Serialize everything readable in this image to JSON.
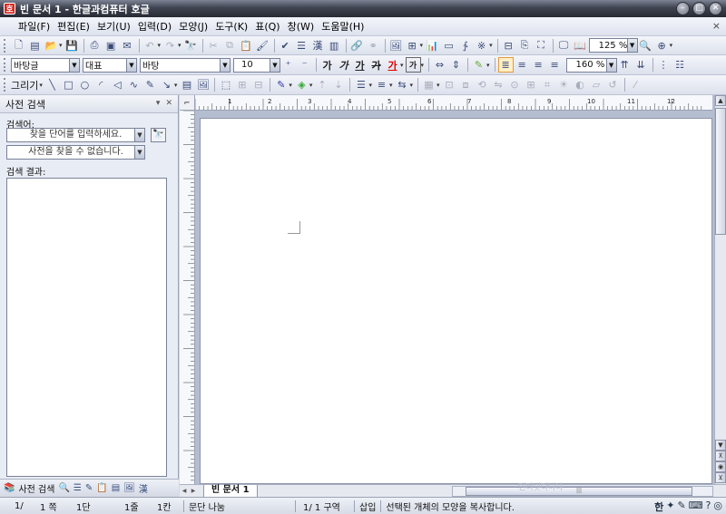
{
  "window": {
    "title": "빈 문서 1 - 한글과컴퓨터 호글",
    "app_icon": "hwp-icon",
    "controls": [
      "minimize",
      "maximize",
      "close"
    ]
  },
  "menubar": {
    "items": [
      "파일(F)",
      "편집(E)",
      "보기(U)",
      "입력(D)",
      "모양(J)",
      "도구(K)",
      "표(Q)",
      "창(W)",
      "도움말(H)"
    ],
    "close_label": "×"
  },
  "toolbar_standard": {
    "zoom": "125 %"
  },
  "toolbar_format": {
    "style": "바탕글",
    "font_lang": "대표",
    "font": "바탕",
    "size": "10",
    "line_spacing": "160 %",
    "bold": "가",
    "italic": "가",
    "underline": "가",
    "strike": "가",
    "color": "가",
    "highlight": "가"
  },
  "toolbar_drawing": {
    "label": "그리기"
  },
  "sidebar": {
    "title": "사전 검색",
    "search_label": "검색어:",
    "search_placeholder": "찾을 단어를 입력하세요.",
    "dictionary_status": "사전을 찾을 수 없습니다.",
    "results_label": "검색 결과:",
    "tab_label": "사전 검색"
  },
  "document": {
    "tab_label": "빈 문서 1",
    "watermark": "인터넷다나나"
  },
  "ruler": {
    "marks": [
      "1",
      "2",
      "3",
      "4",
      "5",
      "6",
      "7",
      "8",
      "9",
      "10",
      "11",
      "12"
    ]
  },
  "statusbar": {
    "page": "1/",
    "page_count": "1 쪽",
    "section": "1단",
    "line": "1줄",
    "column": "1칸",
    "split": "문단 나눔",
    "zone": "1/ 1 구역",
    "insert_mode": "삽입",
    "message": "선택된 개체의 모양을 복사합니다.",
    "ime_label": "한"
  }
}
